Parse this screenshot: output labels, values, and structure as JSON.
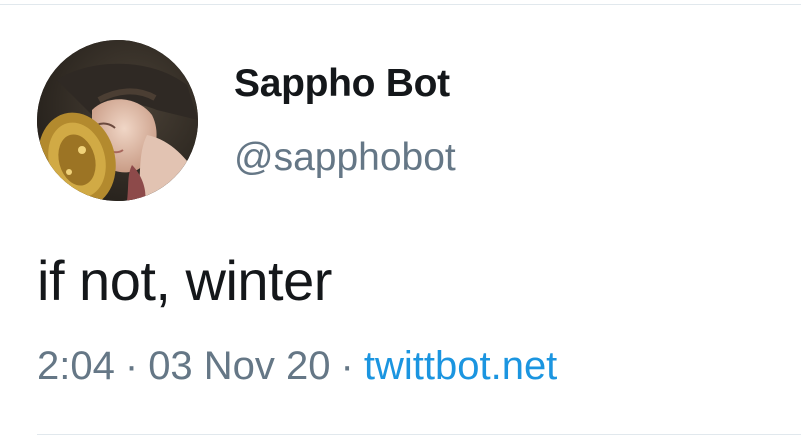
{
  "profile": {
    "display_name": "Sappho Bot",
    "handle": "@sapphobot",
    "avatar_icon": "painting-portrait-avatar"
  },
  "tweet": {
    "text": "if not, winter",
    "time": "2:04",
    "date": "03 Nov 20",
    "separator": "·",
    "source": "twittbot.net"
  },
  "colors": {
    "primary_text": "#14171a",
    "secondary_text": "#657786",
    "link": "#1b95e0",
    "divider": "#e1e8ed"
  }
}
